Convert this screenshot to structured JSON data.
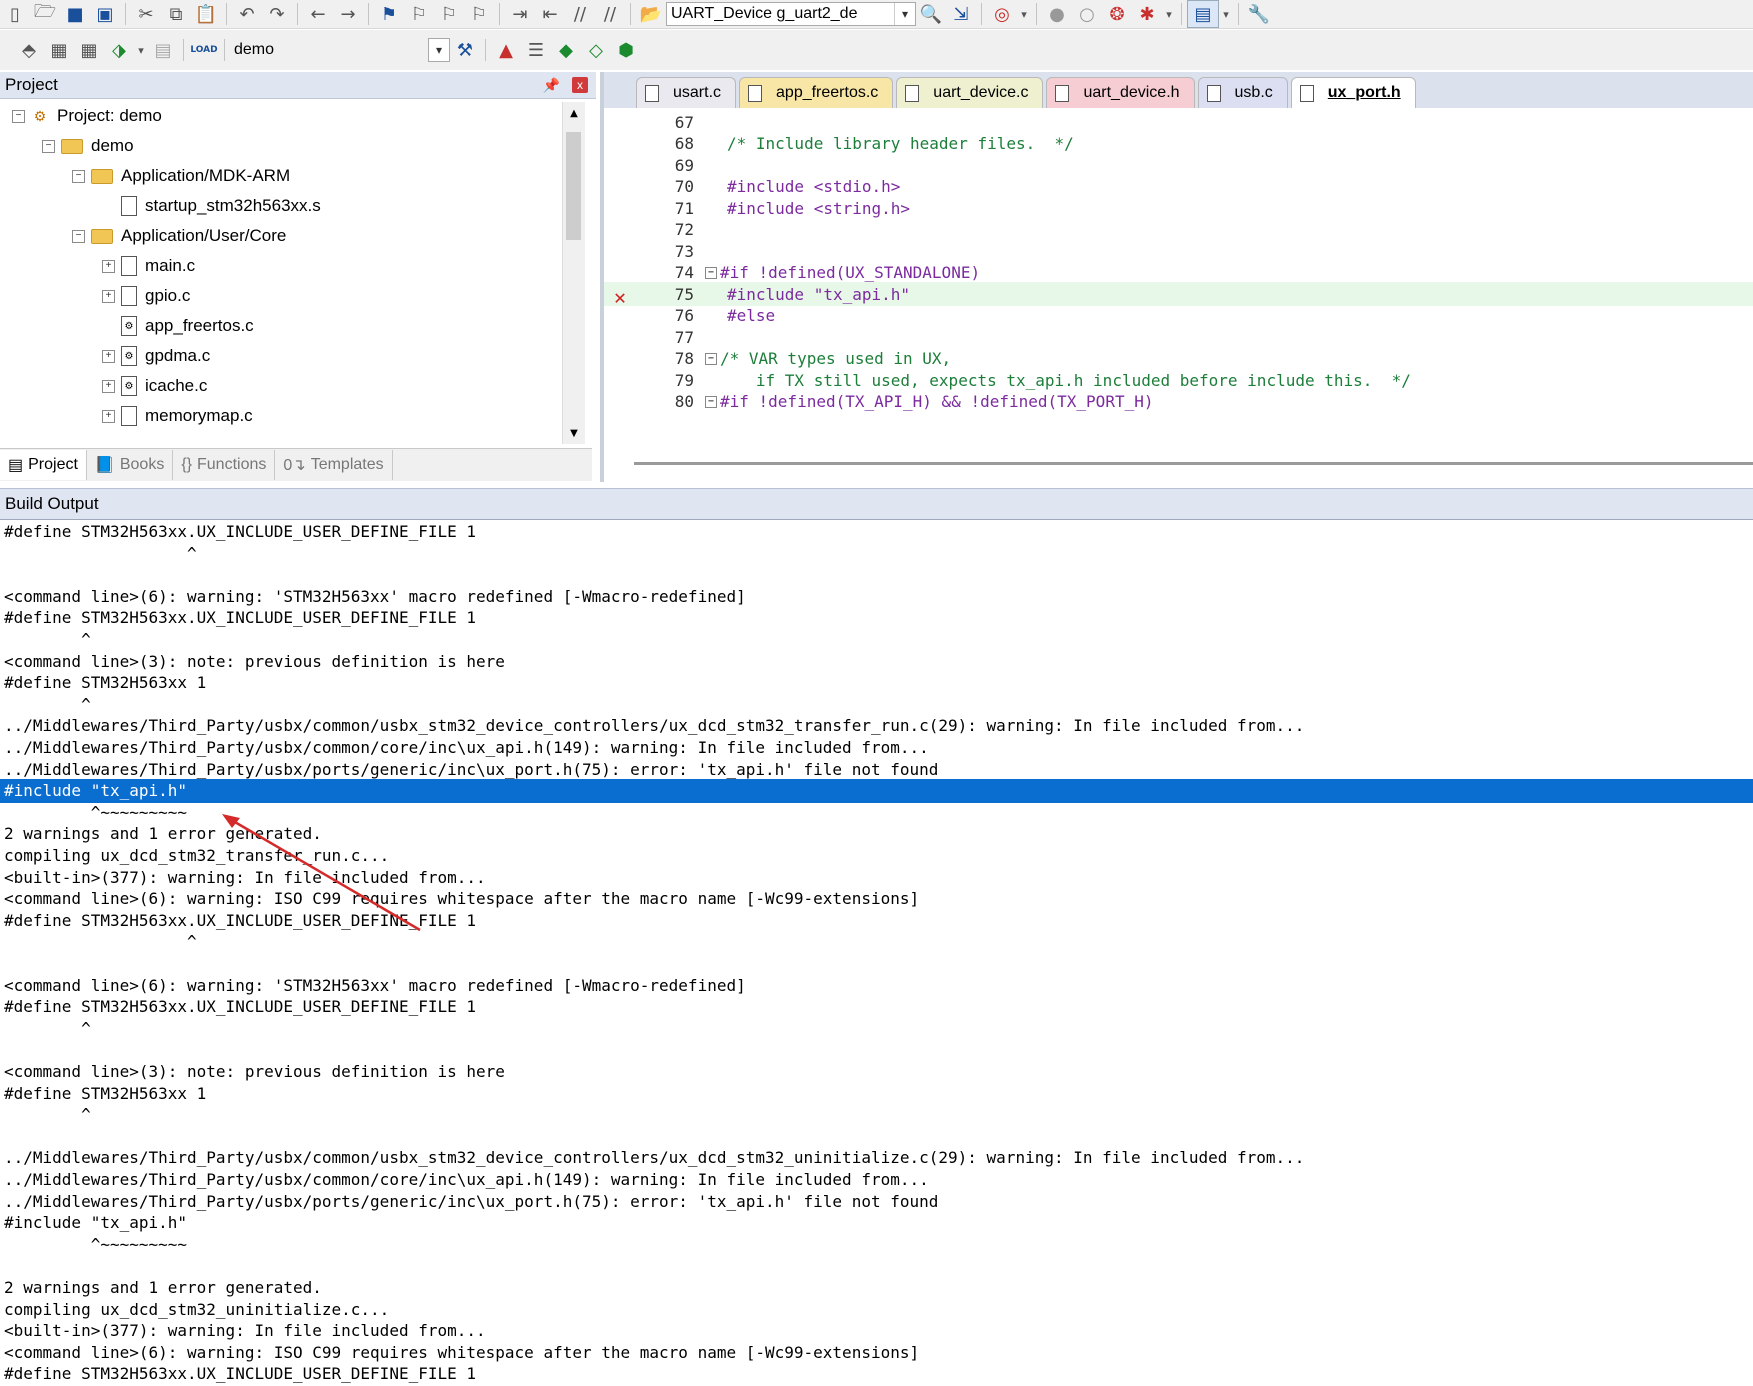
{
  "toolbar1": {
    "target_combo": "UART_Device g_uart2_de"
  },
  "toolbar2": {
    "project_combo": "demo",
    "load_label": "LOAD"
  },
  "project_pane": {
    "title": "Project",
    "pin_icon": "pin-icon",
    "close_label": "x",
    "tree": [
      {
        "label": "Project: demo",
        "level": 0,
        "icon": "project-icon",
        "expander": "minus"
      },
      {
        "label": "demo",
        "level": 1,
        "icon": "target-folder-icon",
        "expander": "minus"
      },
      {
        "label": "Application/MDK-ARM",
        "level": 2,
        "icon": "folder-icon",
        "expander": "minus"
      },
      {
        "label": "startup_stm32h563xx.s",
        "level": 3,
        "icon": "file-icon",
        "expander": "none"
      },
      {
        "label": "Application/User/Core",
        "level": 2,
        "icon": "folder-icon",
        "expander": "minus"
      },
      {
        "label": "main.c",
        "level": 3,
        "icon": "file-icon",
        "expander": "plus"
      },
      {
        "label": "gpio.c",
        "level": 3,
        "icon": "file-icon",
        "expander": "plus"
      },
      {
        "label": "app_freertos.c",
        "level": 3,
        "icon": "gear-file-icon",
        "expander": "none"
      },
      {
        "label": "gpdma.c",
        "level": 3,
        "icon": "gear-file-icon",
        "expander": "plus"
      },
      {
        "label": "icache.c",
        "level": 3,
        "icon": "gear-file-icon",
        "expander": "plus"
      },
      {
        "label": "memorymap.c",
        "level": 3,
        "icon": "file-icon",
        "expander": "plus"
      }
    ],
    "tabs": [
      {
        "label": "Project",
        "active": true
      },
      {
        "label": "Books",
        "active": false
      },
      {
        "label": "Functions",
        "active": false
      },
      {
        "label": "Templates",
        "active": false
      }
    ]
  },
  "editor": {
    "tabs": [
      {
        "label": "usart.c",
        "color": "#e9e9ef",
        "active": false
      },
      {
        "label": "app_freertos.c",
        "color": "#f7e6a6",
        "active": false
      },
      {
        "label": "uart_device.c",
        "color": "#eef0cf",
        "active": false
      },
      {
        "label": "uart_device.h",
        "color": "#f6cdd2",
        "active": false
      },
      {
        "label": "usb.c",
        "color": "#dcdff2",
        "active": false
      },
      {
        "label": "ux_port.h",
        "color": "#ffffff",
        "active": true
      }
    ],
    "lines": [
      {
        "num": "67",
        "text": "",
        "fold": "none",
        "kind": "plain"
      },
      {
        "num": "68",
        "text": "/* Include library header files.  */",
        "fold": "none",
        "kind": "comment"
      },
      {
        "num": "69",
        "text": "",
        "fold": "none",
        "kind": "plain"
      },
      {
        "num": "70",
        "text": "#include <stdio.h>",
        "fold": "none",
        "kind": "include"
      },
      {
        "num": "71",
        "text": "#include <string.h>",
        "fold": "none",
        "kind": "include"
      },
      {
        "num": "72",
        "text": "",
        "fold": "none",
        "kind": "plain"
      },
      {
        "num": "73",
        "text": "",
        "fold": "none",
        "kind": "plain"
      },
      {
        "num": "74",
        "text": "#if !defined(UX_STANDALONE)",
        "fold": "box",
        "kind": "pp"
      },
      {
        "num": "75",
        "text": "#include \"tx_api.h\"",
        "fold": "none",
        "kind": "include",
        "error": true
      },
      {
        "num": "76",
        "text": "#else",
        "fold": "none",
        "kind": "pp"
      },
      {
        "num": "77",
        "text": "",
        "fold": "none",
        "kind": "plain"
      },
      {
        "num": "78",
        "text": "/* VAR types used in UX,",
        "fold": "box",
        "kind": "comment"
      },
      {
        "num": "79",
        "text": "   if TX still used, expects tx_api.h included before include this.  */",
        "fold": "none",
        "kind": "comment"
      },
      {
        "num": "80",
        "text": "#if !defined(TX_API_H) && !defined(TX_PORT_H)",
        "fold": "box",
        "kind": "pp"
      }
    ]
  },
  "build_output": {
    "title": "Build Output",
    "lines": [
      "#define STM32H563xx.UX_INCLUDE_USER_DEFINE_FILE 1",
      "                   ^",
      "",
      "<command line>(6): warning: 'STM32H563xx' macro redefined [-Wmacro-redefined]",
      "#define STM32H563xx.UX_INCLUDE_USER_DEFINE_FILE 1",
      "        ^",
      "<command line>(3): note: previous definition is here",
      "#define STM32H563xx 1",
      "        ^",
      "../Middlewares/Third_Party/usbx/common/usbx_stm32_device_controllers/ux_dcd_stm32_transfer_run.c(29): warning: In file included from...",
      "../Middlewares/Third_Party/usbx/common/core/inc\\ux_api.h(149): warning: In file included from...",
      "../Middlewares/Third_Party/usbx/ports/generic/inc\\ux_port.h(75): error: 'tx_api.h' file not found",
      "#include \"tx_api.h\"",
      "         ^~~~~~~~~~",
      "2 warnings and 1 error generated.",
      "compiling ux_dcd_stm32_transfer_run.c...",
      "<built-in>(377): warning: In file included from...",
      "<command line>(6): warning: ISO C99 requires whitespace after the macro name [-Wc99-extensions]",
      "#define STM32H563xx.UX_INCLUDE_USER_DEFINE_FILE 1",
      "                   ^",
      "",
      "<command line>(6): warning: 'STM32H563xx' macro redefined [-Wmacro-redefined]",
      "#define STM32H563xx.UX_INCLUDE_USER_DEFINE_FILE 1",
      "        ^",
      "",
      "<command line>(3): note: previous definition is here",
      "#define STM32H563xx 1",
      "        ^",
      "",
      "../Middlewares/Third_Party/usbx/common/usbx_stm32_device_controllers/ux_dcd_stm32_uninitialize.c(29): warning: In file included from...",
      "../Middlewares/Third_Party/usbx/common/core/inc\\ux_api.h(149): warning: In file included from...",
      "../Middlewares/Third_Party/usbx/ports/generic/inc\\ux_port.h(75): error: 'tx_api.h' file not found",
      "#include \"tx_api.h\"",
      "         ^~~~~~~~~~",
      "",
      "2 warnings and 1 error generated.",
      "compiling ux_dcd_stm32_uninitialize.c...",
      "<built-in>(377): warning: In file included from...",
      "<command line>(6): warning: ISO C99 requires whitespace after the macro name [-Wc99-extensions]",
      "#define STM32H563xx.UX_INCLUDE_USER_DEFINE_FILE 1"
    ],
    "selected_index": 12,
    "annotation_color": "#d42a2a"
  }
}
